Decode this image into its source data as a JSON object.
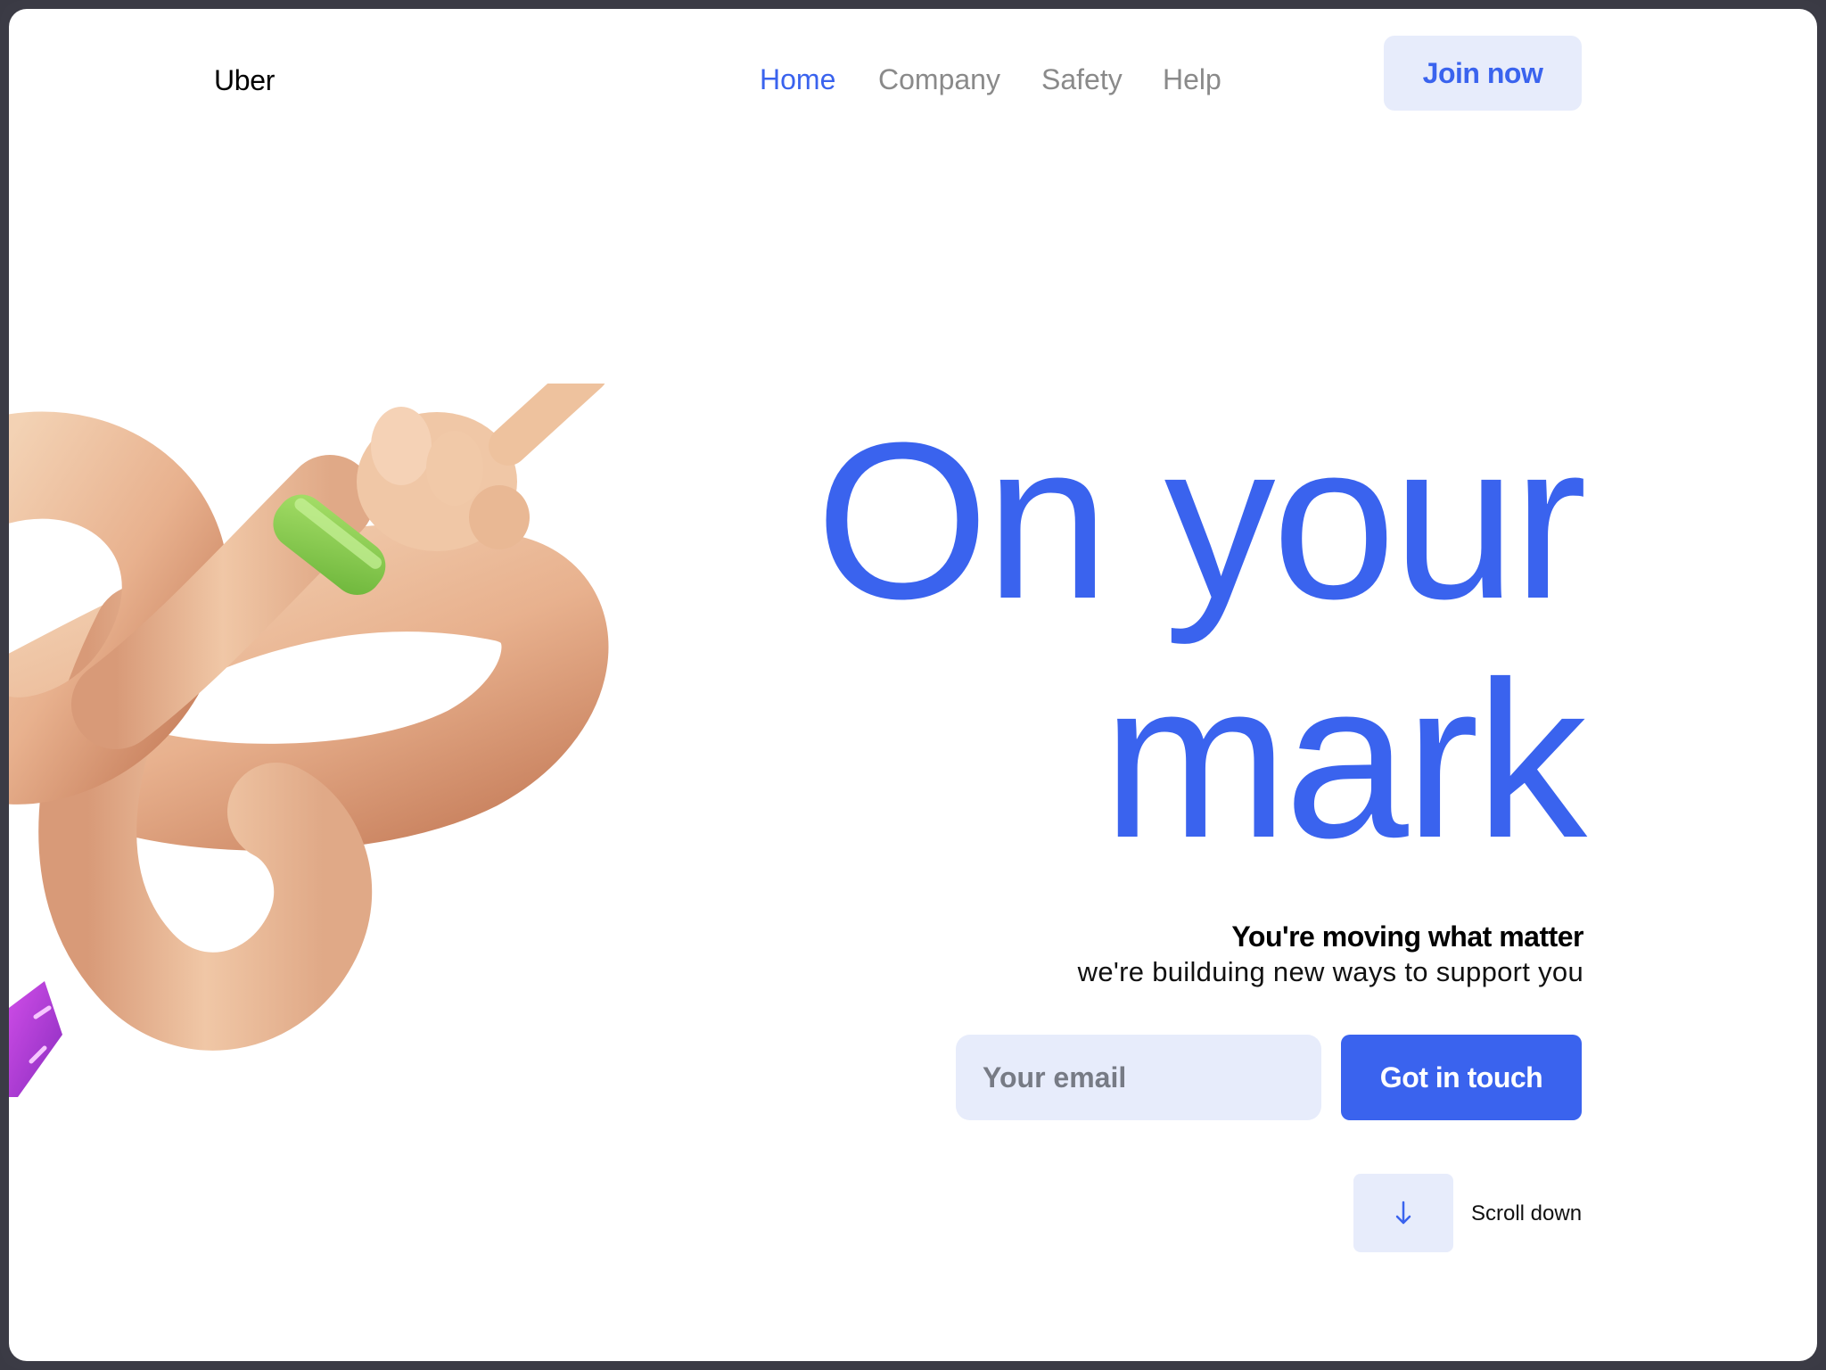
{
  "header": {
    "logo": "Uber",
    "nav": [
      {
        "label": "Home",
        "active": true
      },
      {
        "label": "Company",
        "active": false
      },
      {
        "label": "Safety",
        "active": false
      },
      {
        "label": "Help",
        "active": false
      }
    ],
    "join_label": "Join now"
  },
  "hero": {
    "title_line1": "On your",
    "title_line2": "mark",
    "subtitle_bold": "You're moving what matter",
    "subtitle": "we're builduing new ways to support you"
  },
  "form": {
    "email_placeholder": "Your email",
    "submit_label": "Got in touch"
  },
  "scroll": {
    "icon": "arrow-down-icon",
    "label": "Scroll down"
  },
  "colors": {
    "accent": "#3a63ee",
    "accent_light": "#e7ecfb",
    "nav_inactive": "#8a8a8a",
    "frame": "#3b3b45"
  }
}
